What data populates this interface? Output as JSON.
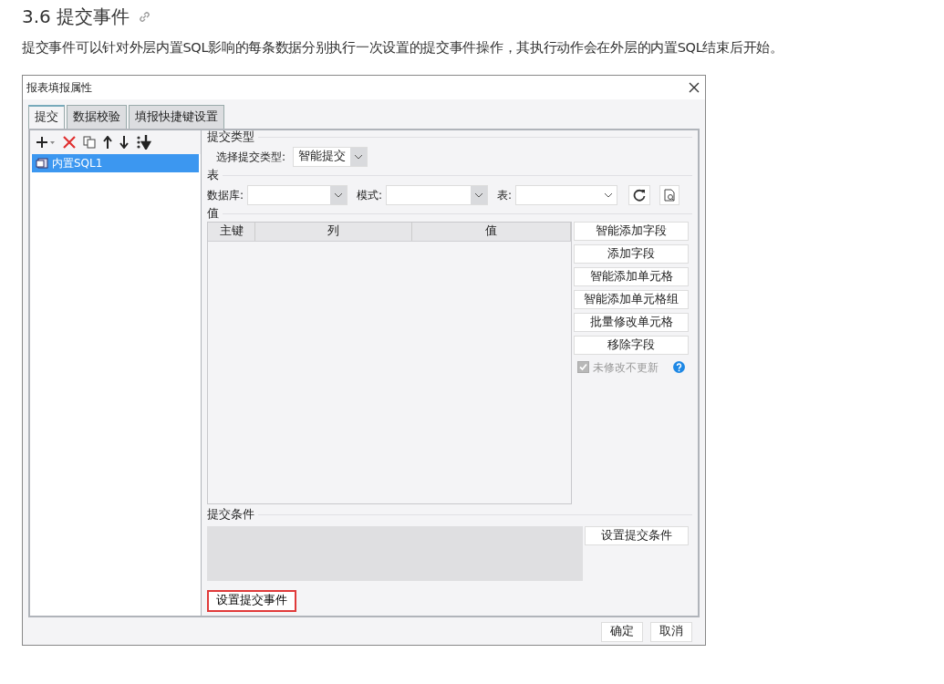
{
  "heading": "3.6 提交事件",
  "paragraph": "提交事件可以针对外层内置SQL影响的每条数据分别执行一次设置的提交事件操作，其执行动作会在外层的内置SQL结束后开始。",
  "dialog": {
    "title": "报表填报属性",
    "tabs": [
      {
        "label": "提交",
        "selected": true
      },
      {
        "label": "数据校验",
        "selected": false
      },
      {
        "label": "填报快捷键设置",
        "selected": false
      }
    ],
    "tree": [
      {
        "label": "内置SQL1",
        "selected": true
      }
    ],
    "submit_type": {
      "legend": "提交类型",
      "label": "选择提交类型:",
      "value": "智能提交"
    },
    "table_section": {
      "legend": "表",
      "fields": [
        {
          "label": "数据库:"
        },
        {
          "label": "模式:"
        },
        {
          "label": "表:"
        }
      ]
    },
    "values_section": {
      "legend": "值",
      "columns": [
        "主键",
        "列",
        "值"
      ],
      "buttons": [
        "智能添加字段",
        "添加字段",
        "智能添加单元格",
        "智能添加单元格组",
        "批量修改单元格",
        "移除字段"
      ],
      "checkbox": {
        "label": "未修改不更新",
        "checked": true,
        "disabled": true
      }
    },
    "condition_section": {
      "legend": "提交条件",
      "button": "设置提交条件"
    },
    "event_button": {
      "label": "设置提交事件",
      "highlighted": true
    },
    "footer_buttons": [
      "确定",
      "取消"
    ]
  }
}
